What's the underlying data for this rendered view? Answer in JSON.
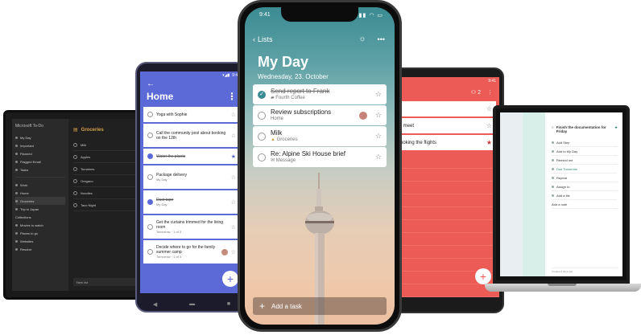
{
  "dark_tablet": {
    "app_title": "Microsoft To-Do",
    "sidebar": [
      "Going Out",
      "My Day",
      "Important",
      "Planned",
      "Flagged Email",
      "Tasks",
      "Work",
      "Home",
      "Groceries",
      "Trip to Japan",
      "Collections",
      "Movies to watch",
      "Places to go",
      "Websites",
      "Resolve"
    ],
    "list_title": "Groceries",
    "rows": [
      "Milk",
      "Apples",
      "Tomatoes",
      "Oregano",
      "Noodles",
      "Taco Night"
    ],
    "new_list": "New list"
  },
  "android": {
    "status_time": "9:41",
    "title": "Home",
    "tasks": [
      {
        "text": "Yoga with Sophie",
        "sub": "",
        "done": false,
        "starred": false
      },
      {
        "text": "Call the community pool about booking on the 12th",
        "sub": "",
        "done": false,
        "starred": false
      },
      {
        "text": "Water the plants",
        "sub": "",
        "done": true,
        "starred": true
      },
      {
        "text": "Package delivery",
        "sub": "My Day",
        "done": false,
        "starred": false
      },
      {
        "text": "Duct tape",
        "sub": "My Day",
        "done": true,
        "starred": false
      },
      {
        "text": "Get the curtains trimmed for the living room",
        "sub": "Tomorrow · 1 of 3",
        "done": false,
        "starred": false
      },
      {
        "text": "Decide where to go for the family summer camp",
        "sub": "Tomorrow · 1 of 3",
        "done": false,
        "starred": false
      }
    ],
    "fab": "+"
  },
  "red_phone": {
    "status_time": "9:41",
    "share_count": "2",
    "tasks": [
      {
        "text": "",
        "starred": false
      },
      {
        "text": "r meet",
        "starred": false
      },
      {
        "text": "ooking the flights",
        "starred": true
      }
    ],
    "fab": "+"
  },
  "laptop": {
    "task_title": "Finish the documentation for Friday",
    "rows": [
      "Add Step",
      "Add to My Day",
      "Remind me",
      "Due Tomorrow",
      "Repeat",
      "Assign to",
      "Add a file",
      "Add a note"
    ],
    "footer": "Created 2 days ago"
  },
  "iphone": {
    "status_time": "9:41",
    "back_label": "Lists",
    "title": "My Day",
    "date": "Wednesday, 23. October",
    "tasks": [
      {
        "text": "Send report to Frank",
        "sub": "Fourth Coffee",
        "done": true,
        "avatar": false
      },
      {
        "text": "Review subscriptions",
        "sub": "Home",
        "done": false,
        "avatar": true
      },
      {
        "text": "Milk",
        "sub": "Groceries",
        "done": false,
        "avatar": false
      },
      {
        "text": "Re: Alpine Ski House brief",
        "sub": "Message",
        "done": false,
        "avatar": false
      }
    ],
    "add_task": "Add a task"
  },
  "colors": {
    "android_accent": "#5b6ad6",
    "red_list": "#ec5b55",
    "iphone_accent": "#3b8b93",
    "groceries_accent": "#d6a14c"
  }
}
